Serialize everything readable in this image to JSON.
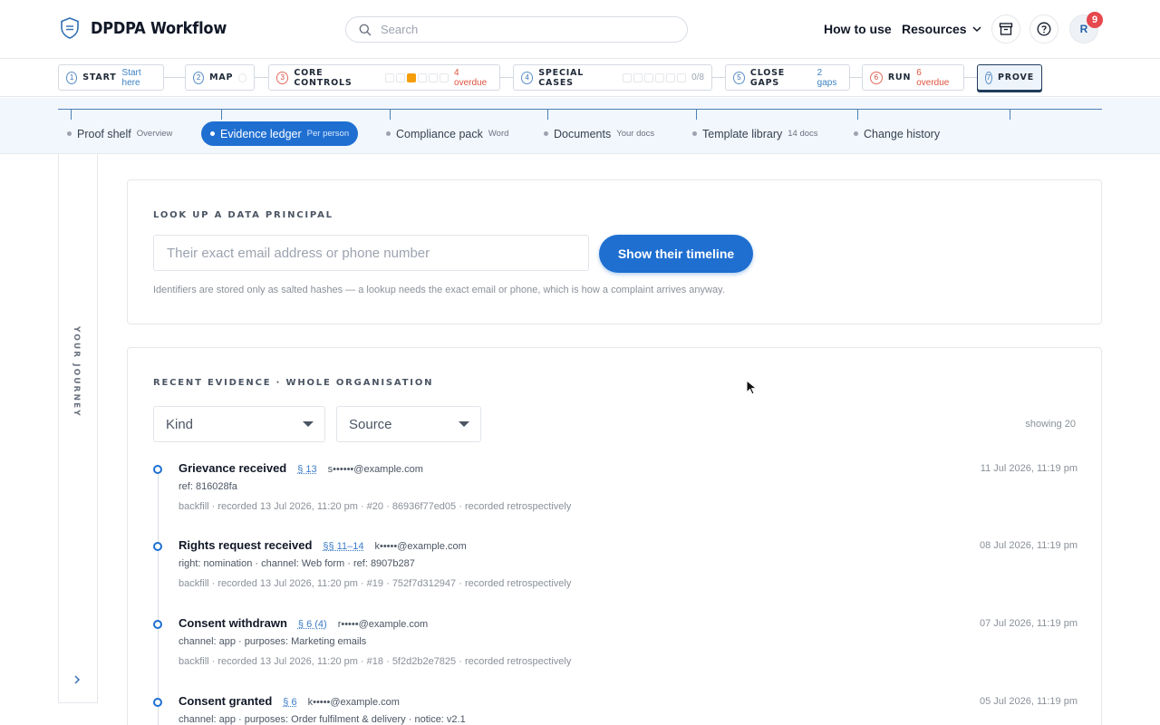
{
  "header": {
    "title": "DPDPA Workflow",
    "search_placeholder": "Search",
    "how_to_use": "How to use",
    "resources": "Resources",
    "avatar_initial": "R",
    "notification_count": "9"
  },
  "steps": [
    {
      "num": "1",
      "label": "START",
      "sub": "Start here"
    },
    {
      "num": "2",
      "label": "MAP",
      "sub": ""
    },
    {
      "num": "3",
      "label": "CORE CONTROLS",
      "sub": "4 overdue"
    },
    {
      "num": "4",
      "label": "SPECIAL CASES",
      "sub": "0/8"
    },
    {
      "num": "5",
      "label": "CLOSE GAPS",
      "sub": "2 gaps"
    },
    {
      "num": "6",
      "label": "RUN",
      "sub": "6 overdue"
    },
    {
      "num": "7",
      "label": "PROVE",
      "sub": ""
    }
  ],
  "subnav": [
    {
      "label": "Proof shelf",
      "hint": "Overview"
    },
    {
      "label": "Evidence ledger",
      "hint": "Per person"
    },
    {
      "label": "Compliance pack",
      "hint": "Word"
    },
    {
      "label": "Documents",
      "hint": "Your docs"
    },
    {
      "label": "Template library",
      "hint": "14 docs"
    },
    {
      "label": "Change history",
      "hint": ""
    }
  ],
  "sidebar": {
    "label": "YOUR JOURNEY"
  },
  "lookup": {
    "title": "LOOK UP A DATA PRINCIPAL",
    "placeholder": "Their exact email address or phone number",
    "button": "Show their timeline",
    "help": "Identifiers are stored only as salted hashes — a lookup needs the exact email or phone, which is how a complaint arrives anyway."
  },
  "recent": {
    "title": "RECENT EVIDENCE · WHOLE ORGANISATION",
    "kind_label": "Kind",
    "source_label": "Source",
    "showing": "showing 20",
    "events": [
      {
        "name": "Grievance received",
        "section": "§ 13",
        "who": "s••••••@example.com",
        "date": "11 Jul 2026, 11:19 pm",
        "detail": "ref: 816028fa",
        "meta": "backfill · recorded 13 Jul 2026, 11:20 pm · #20 · 86936f77ed05 · recorded retrospectively"
      },
      {
        "name": "Rights request received",
        "section": "§§ 11–14",
        "who": "k•••••@example.com",
        "date": "08 Jul 2026, 11:19 pm",
        "detail": "right: nomination · channel: Web form · ref: 8907b287",
        "meta": "backfill · recorded 13 Jul 2026, 11:20 pm · #19 · 752f7d312947 · recorded retrospectively"
      },
      {
        "name": "Consent withdrawn",
        "section": "§ 6 (4)",
        "who": "r•••••@example.com",
        "date": "07 Jul 2026, 11:19 pm",
        "detail": "channel: app · purposes: Marketing emails",
        "meta": "backfill · recorded 13 Jul 2026, 11:20 pm · #18 · 5f2d2b2e7825 · recorded retrospectively"
      },
      {
        "name": "Consent granted",
        "section": "§ 6",
        "who": "k•••••@example.com",
        "date": "05 Jul 2026, 11:19 pm",
        "detail": "channel: app · purposes: Order fulfilment & delivery · notice: v2.1",
        "meta": ""
      }
    ]
  }
}
